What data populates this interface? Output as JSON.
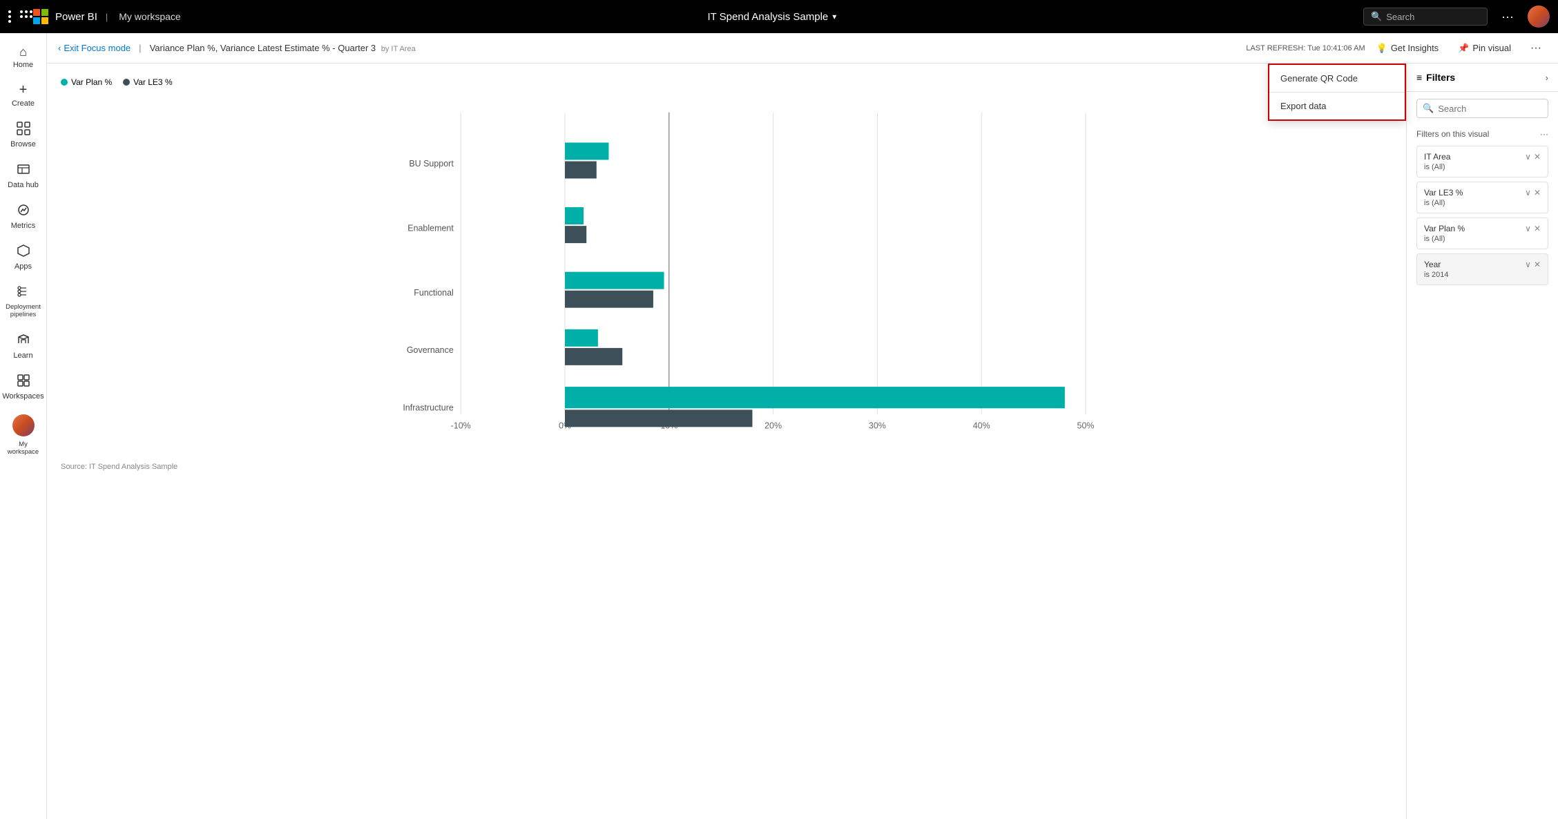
{
  "topbar": {
    "grid_icon": "grid",
    "ms_logo": "microsoft",
    "brand": "Power BI",
    "separator": "|",
    "workspace": "My workspace",
    "report_title": "IT Spend Analysis Sample",
    "chevron": "▾",
    "search_placeholder": "Search",
    "more_label": "···"
  },
  "sub_topbar": {
    "exit_focus_label": "Exit Focus mode",
    "breadcrumb_sep": "|",
    "chart_title": "Variance Plan %, Variance Latest Estimate % - Quarter 3",
    "by_label": "by IT Area",
    "last_refresh_label": "LAST REFRESH:",
    "last_refresh_value": "Tue 10:41:06 AM",
    "get_insights_label": "Get Insights",
    "pin_visual_label": "Pin visual",
    "more_label": "···"
  },
  "sidebar": {
    "items": [
      {
        "id": "home",
        "icon": "⌂",
        "label": "Home"
      },
      {
        "id": "create",
        "icon": "+",
        "label": "Create"
      },
      {
        "id": "browse",
        "icon": "▦",
        "label": "Browse"
      },
      {
        "id": "datahub",
        "icon": "⚙",
        "label": "Data hub"
      },
      {
        "id": "metrics",
        "icon": "◈",
        "label": "Metrics"
      },
      {
        "id": "apps",
        "icon": "⬡",
        "label": "Apps"
      },
      {
        "id": "pipelines",
        "icon": "⋮",
        "label": "Deployment pipelines"
      },
      {
        "id": "learn",
        "icon": "📖",
        "label": "Learn"
      },
      {
        "id": "workspaces",
        "icon": "⊞",
        "label": "Workspaces"
      },
      {
        "id": "myworkspace",
        "icon": "avatar",
        "label": "My workspace"
      }
    ]
  },
  "chart": {
    "legend": [
      {
        "id": "var_plan",
        "label": "Var Plan %",
        "color": "#00b0a8"
      },
      {
        "id": "var_le3",
        "label": "Var LE3 %",
        "color": "#3d4f58"
      }
    ],
    "categories": [
      "BU Support",
      "Enablement",
      "Functional",
      "Governance",
      "Infrastructure"
    ],
    "var_plan_values": [
      4.2,
      1.8,
      9.5,
      3.2,
      48.0
    ],
    "var_le3_values": [
      3.0,
      2.1,
      8.5,
      5.5,
      18.0
    ],
    "x_axis_labels": [
      "-10%",
      "0%",
      "10%",
      "20%",
      "30%",
      "40%",
      "50%"
    ],
    "source_label": "Source: IT Spend Analysis Sample"
  },
  "context_menu": {
    "items": [
      {
        "id": "generate_qr",
        "label": "Generate QR Code"
      },
      {
        "id": "export_data",
        "label": "Export data"
      }
    ]
  },
  "filters": {
    "title": "Filters",
    "search_placeholder": "Search",
    "on_visual_label": "Filters on this visual",
    "more_label": "···",
    "items": [
      {
        "id": "it_area",
        "name": "IT Area",
        "value": "is (All)"
      },
      {
        "id": "var_le3",
        "name": "Var LE3 %",
        "value": "is (All)"
      },
      {
        "id": "var_plan",
        "name": "Var Plan %",
        "value": "is (All)"
      },
      {
        "id": "year",
        "name": "Year",
        "value": "is 2014",
        "active": true
      }
    ]
  }
}
